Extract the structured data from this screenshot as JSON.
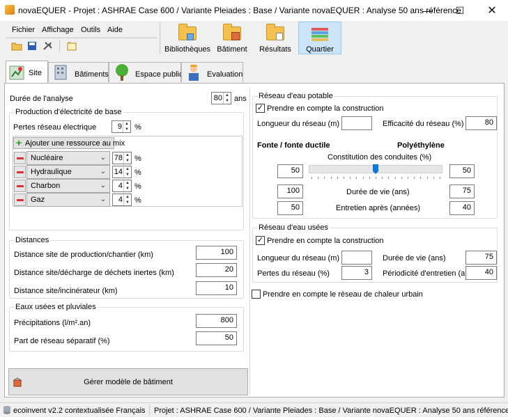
{
  "window": {
    "title": "novaEQUER -  Projet : ASHRAE Case 600 / Variante Pleiades : Base / Variante novaEQUER : Analyse 50 ans référence"
  },
  "menu": [
    "Fichier",
    "Affichage",
    "Outils",
    "Aide"
  ],
  "ribbon": [
    "Bibliothèques",
    "Bâtiment",
    "Résultats",
    "Quartier"
  ],
  "tabs": [
    "Site",
    "Bâtiments",
    "Espace public",
    "Evaluation"
  ],
  "site": {
    "duree_label": "Durée de l'analyse",
    "duree_value": "80",
    "duree_unit": "ans",
    "elec": {
      "title": "Production d'électricité de base",
      "pertes_label": "Pertes réseau électrique",
      "pertes_value": "9",
      "pertes_unit": "%",
      "add_label": "Ajouter une ressource au mix",
      "mix": [
        {
          "name": "Nucléaire",
          "value": "78",
          "unit": "%"
        },
        {
          "name": "Hydraulique",
          "value": "14",
          "unit": "%"
        },
        {
          "name": "Charbon",
          "value": "4",
          "unit": "%"
        },
        {
          "name": "Gaz",
          "value": "4",
          "unit": "%"
        }
      ]
    },
    "distances": {
      "title": "Distances",
      "rows": [
        {
          "label": "Distance site de production/chantier (km)",
          "value": "100"
        },
        {
          "label": "Distance site/décharge de déchets inertes (km)",
          "value": "20"
        },
        {
          "label": "Distance site/incinérateur (km)",
          "value": "10"
        }
      ]
    },
    "eaux": {
      "title": "Eaux usées et pluviales",
      "rows": [
        {
          "label": "Précipitations (l/m².an)",
          "value": "800"
        },
        {
          "label": "Part de réseau séparatif (%)",
          "value": "50"
        }
      ]
    },
    "gerer_label": "Gérer modèle de bâtiment"
  },
  "potable": {
    "title": "Réseau d'eau potable",
    "prendre_label": "Prendre en compte la construction",
    "longueur_label": "Longueur du réseau (m)",
    "longueur_value": "",
    "efficacite_label": "Efficacité du réseau (%)",
    "efficacite_value": "80",
    "fonte_label": "Fonte / fonte ductile",
    "poly_label": "Polyéthylène",
    "constitution_label": "Constitution des conduites (%)",
    "fonte_pct": "50",
    "poly_pct": "50",
    "slider_fraction": 0.5,
    "duree_label": "Durée de vie (ans)",
    "duree_fonte": "100",
    "duree_poly": "75",
    "entretien_label": "Entretien après (années)",
    "entretien_fonte": "50",
    "entretien_poly": "40"
  },
  "usees": {
    "title": "Réseau d'eau usées",
    "prendre_label": "Prendre en compte la construction",
    "longueur_label": "Longueur du réseau (m)",
    "longueur_value": "",
    "duree_label": "Durée de vie (ans)",
    "duree_value": "75",
    "pertes_label": "Pertes du réseau (%)",
    "pertes_value": "3",
    "period_label": "Périodicité d'entretien (ans)",
    "period_value": "40"
  },
  "chaleur_label": "Prendre en compte le réseau de chaleur urbain",
  "status": {
    "db": "ecoinvent v2.2 contextualisée Français",
    "project": "Projet : ASHRAE Case 600 / Variante Pleiades : Base / Variante novaEQUER : Analyse 50 ans référence"
  }
}
